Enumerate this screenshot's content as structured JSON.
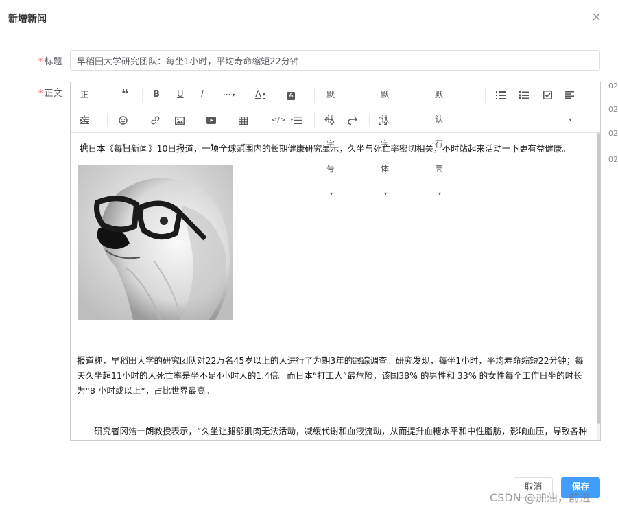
{
  "dialog": {
    "title": "新增新闻"
  },
  "form": {
    "title_label": "标题",
    "title_value": "早稻田大学研究团队：每坐1小时，平均寿命缩短22分钟",
    "body_label": "正文",
    "required_mark": "*"
  },
  "toolbar": {
    "row1": {
      "heading": "正文",
      "more": "···",
      "font_color": "A",
      "bg_color": "A",
      "font_size": "默认字号",
      "font_family": "默认字体",
      "line_height": "默认行高"
    }
  },
  "article": {
    "p1": "据日本《每日新闻》10日报道，一项全球范围内的长期健康研究显示，久坐与死亡率密切相关，不时站起来活动一下更有益健康。",
    "p2": "报道称，早稻田大学的研究团队对22万名45岁以上的人进行了为期3年的跟踪调查。研究发现，每坐1小时，平均寿命缩短22分钟；每天久坐超11小时的人死亡率是坐不足4小时人的1.4倍。而日本“打工人”最危险，该国38% 的男性和 33% 的女性每个工作日坐的时长为“8 小时或以上”，占比世界最高。",
    "p3": "研究者冈浩一朗教授表示，“久坐让腿部肌肉无法活动，减缓代谢和血液流动，从而提升血糖水平和中性脂肪，影响血压，导致各种疾病。”不便的问题的关键在于大脑指令，他建议人们每30分钟活动一下，哪怕只是跟腿脚、转腰、伸伸懒腰都可以。"
  },
  "edge_fragments": [
    "02",
    "02",
    "02",
    "02"
  ],
  "footer": {
    "cancel_label": "取消",
    "save_label": "保存"
  },
  "watermark": "CSDN @加油，前进",
  "colors": {
    "primary": "#409eff",
    "required": "#f56c6c",
    "border": "#dcdfe6"
  }
}
